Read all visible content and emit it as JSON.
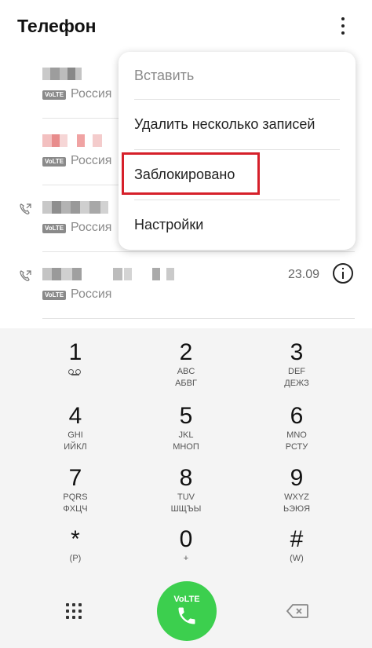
{
  "header": {
    "title": "Телефон"
  },
  "calls": [
    {
      "volte": "VoLTE",
      "location": "Россия",
      "date": ""
    },
    {
      "volte": "VoLTE",
      "location": "Россия",
      "date": ""
    },
    {
      "volte": "VoLTE",
      "location": "Россия",
      "date": ""
    },
    {
      "volte": "VoLTE",
      "location": "Россия",
      "date": "23.09"
    }
  ],
  "menu": {
    "items": [
      {
        "label": "Вставить"
      },
      {
        "label": "Удалить несколько записей"
      },
      {
        "label": "Заблокировано"
      },
      {
        "label": "Настройки"
      }
    ],
    "highlighted_item": "Заблокировано",
    "highlight_color": "#d6202a"
  },
  "keypad": [
    {
      "digit": "1",
      "latin": "",
      "cyrillic": "",
      "icon": "voicemail-icon"
    },
    {
      "digit": "2",
      "latin": "ABC",
      "cyrillic": "АБВГ"
    },
    {
      "digit": "3",
      "latin": "DEF",
      "cyrillic": "ДЕЖЗ"
    },
    {
      "digit": "4",
      "latin": "GHI",
      "cyrillic": "ИЙКЛ"
    },
    {
      "digit": "5",
      "latin": "JKL",
      "cyrillic": "МНОП"
    },
    {
      "digit": "6",
      "latin": "MNO",
      "cyrillic": "РСТУ"
    },
    {
      "digit": "7",
      "latin": "PQRS",
      "cyrillic": "ФХЦЧ"
    },
    {
      "digit": "8",
      "latin": "TUV",
      "cyrillic": "ШЩЪЫ"
    },
    {
      "digit": "9",
      "latin": "WXYZ",
      "cyrillic": "ЬЭЮЯ"
    },
    {
      "digit": "*",
      "latin": "(P)",
      "cyrillic": ""
    },
    {
      "digit": "0",
      "latin": "+",
      "cyrillic": ""
    },
    {
      "digit": "#",
      "latin": "(W)",
      "cyrillic": ""
    }
  ],
  "bottom": {
    "call_label": "VoLTE",
    "call_color": "#3ccf4e"
  }
}
